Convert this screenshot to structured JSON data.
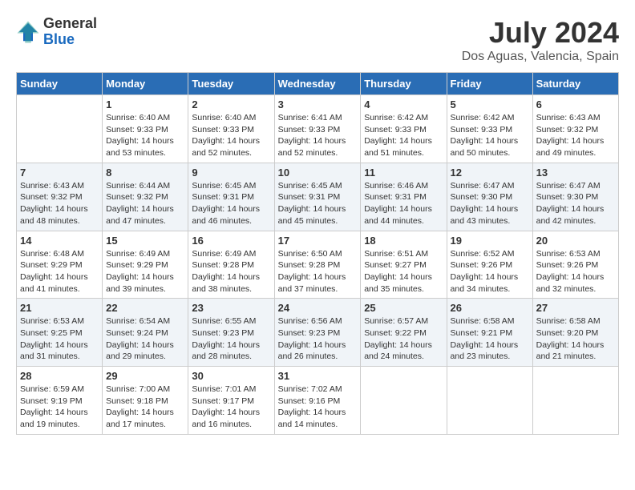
{
  "logo": {
    "general": "General",
    "blue": "Blue"
  },
  "header": {
    "month": "July 2024",
    "location": "Dos Aguas, Valencia, Spain"
  },
  "weekdays": [
    "Sunday",
    "Monday",
    "Tuesday",
    "Wednesday",
    "Thursday",
    "Friday",
    "Saturday"
  ],
  "weeks": [
    [
      {
        "day": "",
        "sunrise": "",
        "sunset": "",
        "daylight": ""
      },
      {
        "day": "1",
        "sunrise": "Sunrise: 6:40 AM",
        "sunset": "Sunset: 9:33 PM",
        "daylight": "Daylight: 14 hours and 53 minutes."
      },
      {
        "day": "2",
        "sunrise": "Sunrise: 6:40 AM",
        "sunset": "Sunset: 9:33 PM",
        "daylight": "Daylight: 14 hours and 52 minutes."
      },
      {
        "day": "3",
        "sunrise": "Sunrise: 6:41 AM",
        "sunset": "Sunset: 9:33 PM",
        "daylight": "Daylight: 14 hours and 52 minutes."
      },
      {
        "day": "4",
        "sunrise": "Sunrise: 6:42 AM",
        "sunset": "Sunset: 9:33 PM",
        "daylight": "Daylight: 14 hours and 51 minutes."
      },
      {
        "day": "5",
        "sunrise": "Sunrise: 6:42 AM",
        "sunset": "Sunset: 9:33 PM",
        "daylight": "Daylight: 14 hours and 50 minutes."
      },
      {
        "day": "6",
        "sunrise": "Sunrise: 6:43 AM",
        "sunset": "Sunset: 9:32 PM",
        "daylight": "Daylight: 14 hours and 49 minutes."
      }
    ],
    [
      {
        "day": "7",
        "sunrise": "Sunrise: 6:43 AM",
        "sunset": "Sunset: 9:32 PM",
        "daylight": "Daylight: 14 hours and 48 minutes."
      },
      {
        "day": "8",
        "sunrise": "Sunrise: 6:44 AM",
        "sunset": "Sunset: 9:32 PM",
        "daylight": "Daylight: 14 hours and 47 minutes."
      },
      {
        "day": "9",
        "sunrise": "Sunrise: 6:45 AM",
        "sunset": "Sunset: 9:31 PM",
        "daylight": "Daylight: 14 hours and 46 minutes."
      },
      {
        "day": "10",
        "sunrise": "Sunrise: 6:45 AM",
        "sunset": "Sunset: 9:31 PM",
        "daylight": "Daylight: 14 hours and 45 minutes."
      },
      {
        "day": "11",
        "sunrise": "Sunrise: 6:46 AM",
        "sunset": "Sunset: 9:31 PM",
        "daylight": "Daylight: 14 hours and 44 minutes."
      },
      {
        "day": "12",
        "sunrise": "Sunrise: 6:47 AM",
        "sunset": "Sunset: 9:30 PM",
        "daylight": "Daylight: 14 hours and 43 minutes."
      },
      {
        "day": "13",
        "sunrise": "Sunrise: 6:47 AM",
        "sunset": "Sunset: 9:30 PM",
        "daylight": "Daylight: 14 hours and 42 minutes."
      }
    ],
    [
      {
        "day": "14",
        "sunrise": "Sunrise: 6:48 AM",
        "sunset": "Sunset: 9:29 PM",
        "daylight": "Daylight: 14 hours and 41 minutes."
      },
      {
        "day": "15",
        "sunrise": "Sunrise: 6:49 AM",
        "sunset": "Sunset: 9:29 PM",
        "daylight": "Daylight: 14 hours and 39 minutes."
      },
      {
        "day": "16",
        "sunrise": "Sunrise: 6:49 AM",
        "sunset": "Sunset: 9:28 PM",
        "daylight": "Daylight: 14 hours and 38 minutes."
      },
      {
        "day": "17",
        "sunrise": "Sunrise: 6:50 AM",
        "sunset": "Sunset: 9:28 PM",
        "daylight": "Daylight: 14 hours and 37 minutes."
      },
      {
        "day": "18",
        "sunrise": "Sunrise: 6:51 AM",
        "sunset": "Sunset: 9:27 PM",
        "daylight": "Daylight: 14 hours and 35 minutes."
      },
      {
        "day": "19",
        "sunrise": "Sunrise: 6:52 AM",
        "sunset": "Sunset: 9:26 PM",
        "daylight": "Daylight: 14 hours and 34 minutes."
      },
      {
        "day": "20",
        "sunrise": "Sunrise: 6:53 AM",
        "sunset": "Sunset: 9:26 PM",
        "daylight": "Daylight: 14 hours and 32 minutes."
      }
    ],
    [
      {
        "day": "21",
        "sunrise": "Sunrise: 6:53 AM",
        "sunset": "Sunset: 9:25 PM",
        "daylight": "Daylight: 14 hours and 31 minutes."
      },
      {
        "day": "22",
        "sunrise": "Sunrise: 6:54 AM",
        "sunset": "Sunset: 9:24 PM",
        "daylight": "Daylight: 14 hours and 29 minutes."
      },
      {
        "day": "23",
        "sunrise": "Sunrise: 6:55 AM",
        "sunset": "Sunset: 9:23 PM",
        "daylight": "Daylight: 14 hours and 28 minutes."
      },
      {
        "day": "24",
        "sunrise": "Sunrise: 6:56 AM",
        "sunset": "Sunset: 9:23 PM",
        "daylight": "Daylight: 14 hours and 26 minutes."
      },
      {
        "day": "25",
        "sunrise": "Sunrise: 6:57 AM",
        "sunset": "Sunset: 9:22 PM",
        "daylight": "Daylight: 14 hours and 24 minutes."
      },
      {
        "day": "26",
        "sunrise": "Sunrise: 6:58 AM",
        "sunset": "Sunset: 9:21 PM",
        "daylight": "Daylight: 14 hours and 23 minutes."
      },
      {
        "day": "27",
        "sunrise": "Sunrise: 6:58 AM",
        "sunset": "Sunset: 9:20 PM",
        "daylight": "Daylight: 14 hours and 21 minutes."
      }
    ],
    [
      {
        "day": "28",
        "sunrise": "Sunrise: 6:59 AM",
        "sunset": "Sunset: 9:19 PM",
        "daylight": "Daylight: 14 hours and 19 minutes."
      },
      {
        "day": "29",
        "sunrise": "Sunrise: 7:00 AM",
        "sunset": "Sunset: 9:18 PM",
        "daylight": "Daylight: 14 hours and 17 minutes."
      },
      {
        "day": "30",
        "sunrise": "Sunrise: 7:01 AM",
        "sunset": "Sunset: 9:17 PM",
        "daylight": "Daylight: 14 hours and 16 minutes."
      },
      {
        "day": "31",
        "sunrise": "Sunrise: 7:02 AM",
        "sunset": "Sunset: 9:16 PM",
        "daylight": "Daylight: 14 hours and 14 minutes."
      },
      {
        "day": "",
        "sunrise": "",
        "sunset": "",
        "daylight": ""
      },
      {
        "day": "",
        "sunrise": "",
        "sunset": "",
        "daylight": ""
      },
      {
        "day": "",
        "sunrise": "",
        "sunset": "",
        "daylight": ""
      }
    ]
  ]
}
